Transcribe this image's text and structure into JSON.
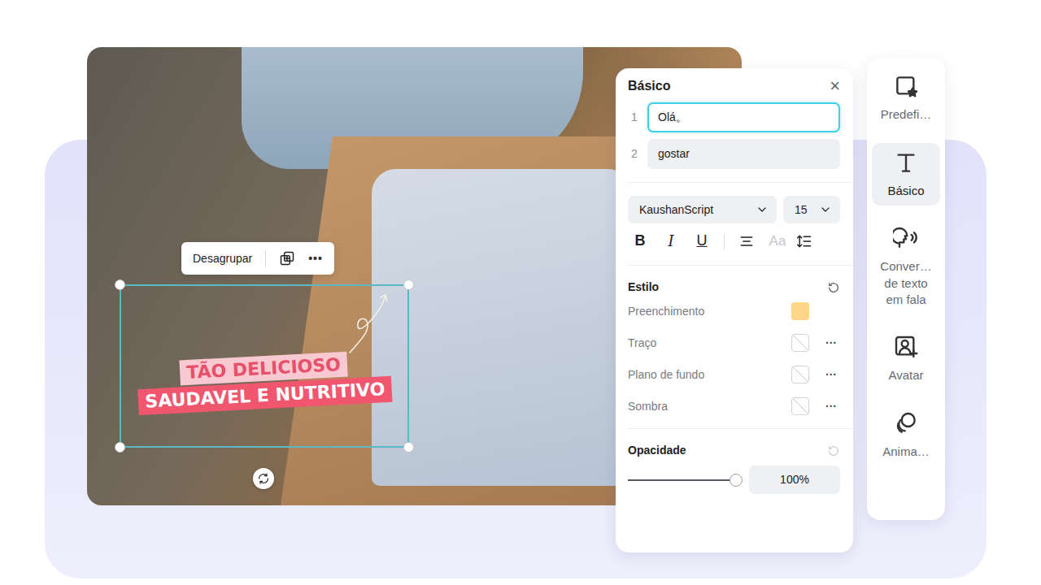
{
  "canvas": {
    "toolbar": {
      "ungroup": "Desagrupar",
      "more": "•••"
    },
    "text_group": {
      "lines": [
        "TÃO DELICIOSO",
        "SAUDAVEL E NUTRITIVO"
      ],
      "selected": true
    }
  },
  "panel": {
    "title": "Básico",
    "close": "×",
    "texts": [
      {
        "index": "1",
        "value": "Olá。",
        "selected": true
      },
      {
        "index": "2",
        "value": "gostar",
        "selected": false
      }
    ],
    "font": "KaushanScript",
    "size": "15",
    "format": [
      {
        "label": "B",
        "kind": "bold"
      },
      {
        "label": "I",
        "kind": "italic"
      },
      {
        "label": "U",
        "kind": "underline"
      }
    ],
    "case": {
      "label": "Aa",
      "disabled": true
    },
    "style": {
      "title": "Estilo",
      "reset_disabled": false,
      "rows": [
        {
          "label": "Preenchimento",
          "kind": "color",
          "color": "#fdd68a"
        },
        {
          "label": "Traço",
          "kind": "none",
          "more": "···"
        },
        {
          "label": "Plano de fundo",
          "kind": "none",
          "more": "···"
        },
        {
          "label": "Sombra",
          "kind": "none",
          "more": "···"
        }
      ]
    },
    "opacity": {
      "title": "Opacidade",
      "reset_disabled": true,
      "level": 1,
      "reading": "100%"
    }
  },
  "sidebar": [
    {
      "label": "Predefi…",
      "selected": false
    },
    {
      "label": "Básico",
      "selected": true
    },
    {
      "label": "Conver… de texto em fala",
      "selected": false
    },
    {
      "label": "Avatar",
      "selected": false
    },
    {
      "label": "Anima…",
      "selected": false
    }
  ]
}
